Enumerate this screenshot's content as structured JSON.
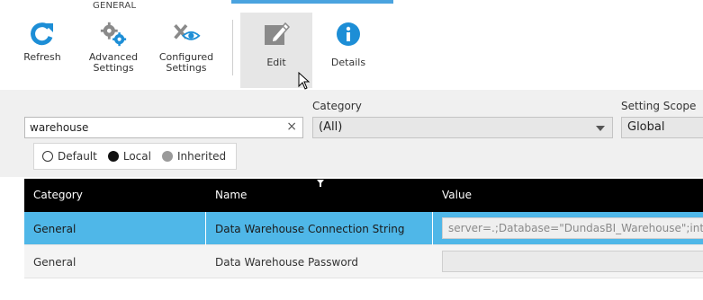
{
  "ribbon": {
    "group_label": "GENERAL",
    "buttons": [
      {
        "label": "Refresh",
        "icon": "refresh-icon"
      },
      {
        "label": "Advanced\nSettings",
        "icon": "advanced-settings-icon"
      },
      {
        "label": "Configured\nSettings",
        "icon": "configured-settings-icon"
      },
      {
        "label": "Edit",
        "icon": "edit-icon"
      },
      {
        "label": "Details",
        "icon": "info-icon"
      }
    ],
    "accent_color": "#4aa3df",
    "icon_color": "#1d8ed6"
  },
  "filters": {
    "search_value": "warehouse",
    "clear_glyph": "×",
    "category_label": "Category",
    "category_value": "(All)",
    "scope_label": "Setting Scope",
    "scope_value": "Global",
    "radio": {
      "default": "Default",
      "local": "Local",
      "inherited": "Inherited"
    }
  },
  "table": {
    "headers": {
      "category": "Category",
      "name": "Name",
      "value": "Value"
    },
    "rows": [
      {
        "category": "General",
        "name": "Data Warehouse Connection String",
        "value": "server=.;Database=\"DundasBI_Warehouse\";integrated"
      },
      {
        "category": "General",
        "name": "Data Warehouse Password",
        "value": ""
      }
    ],
    "selected_color": "#4fb7e8"
  }
}
